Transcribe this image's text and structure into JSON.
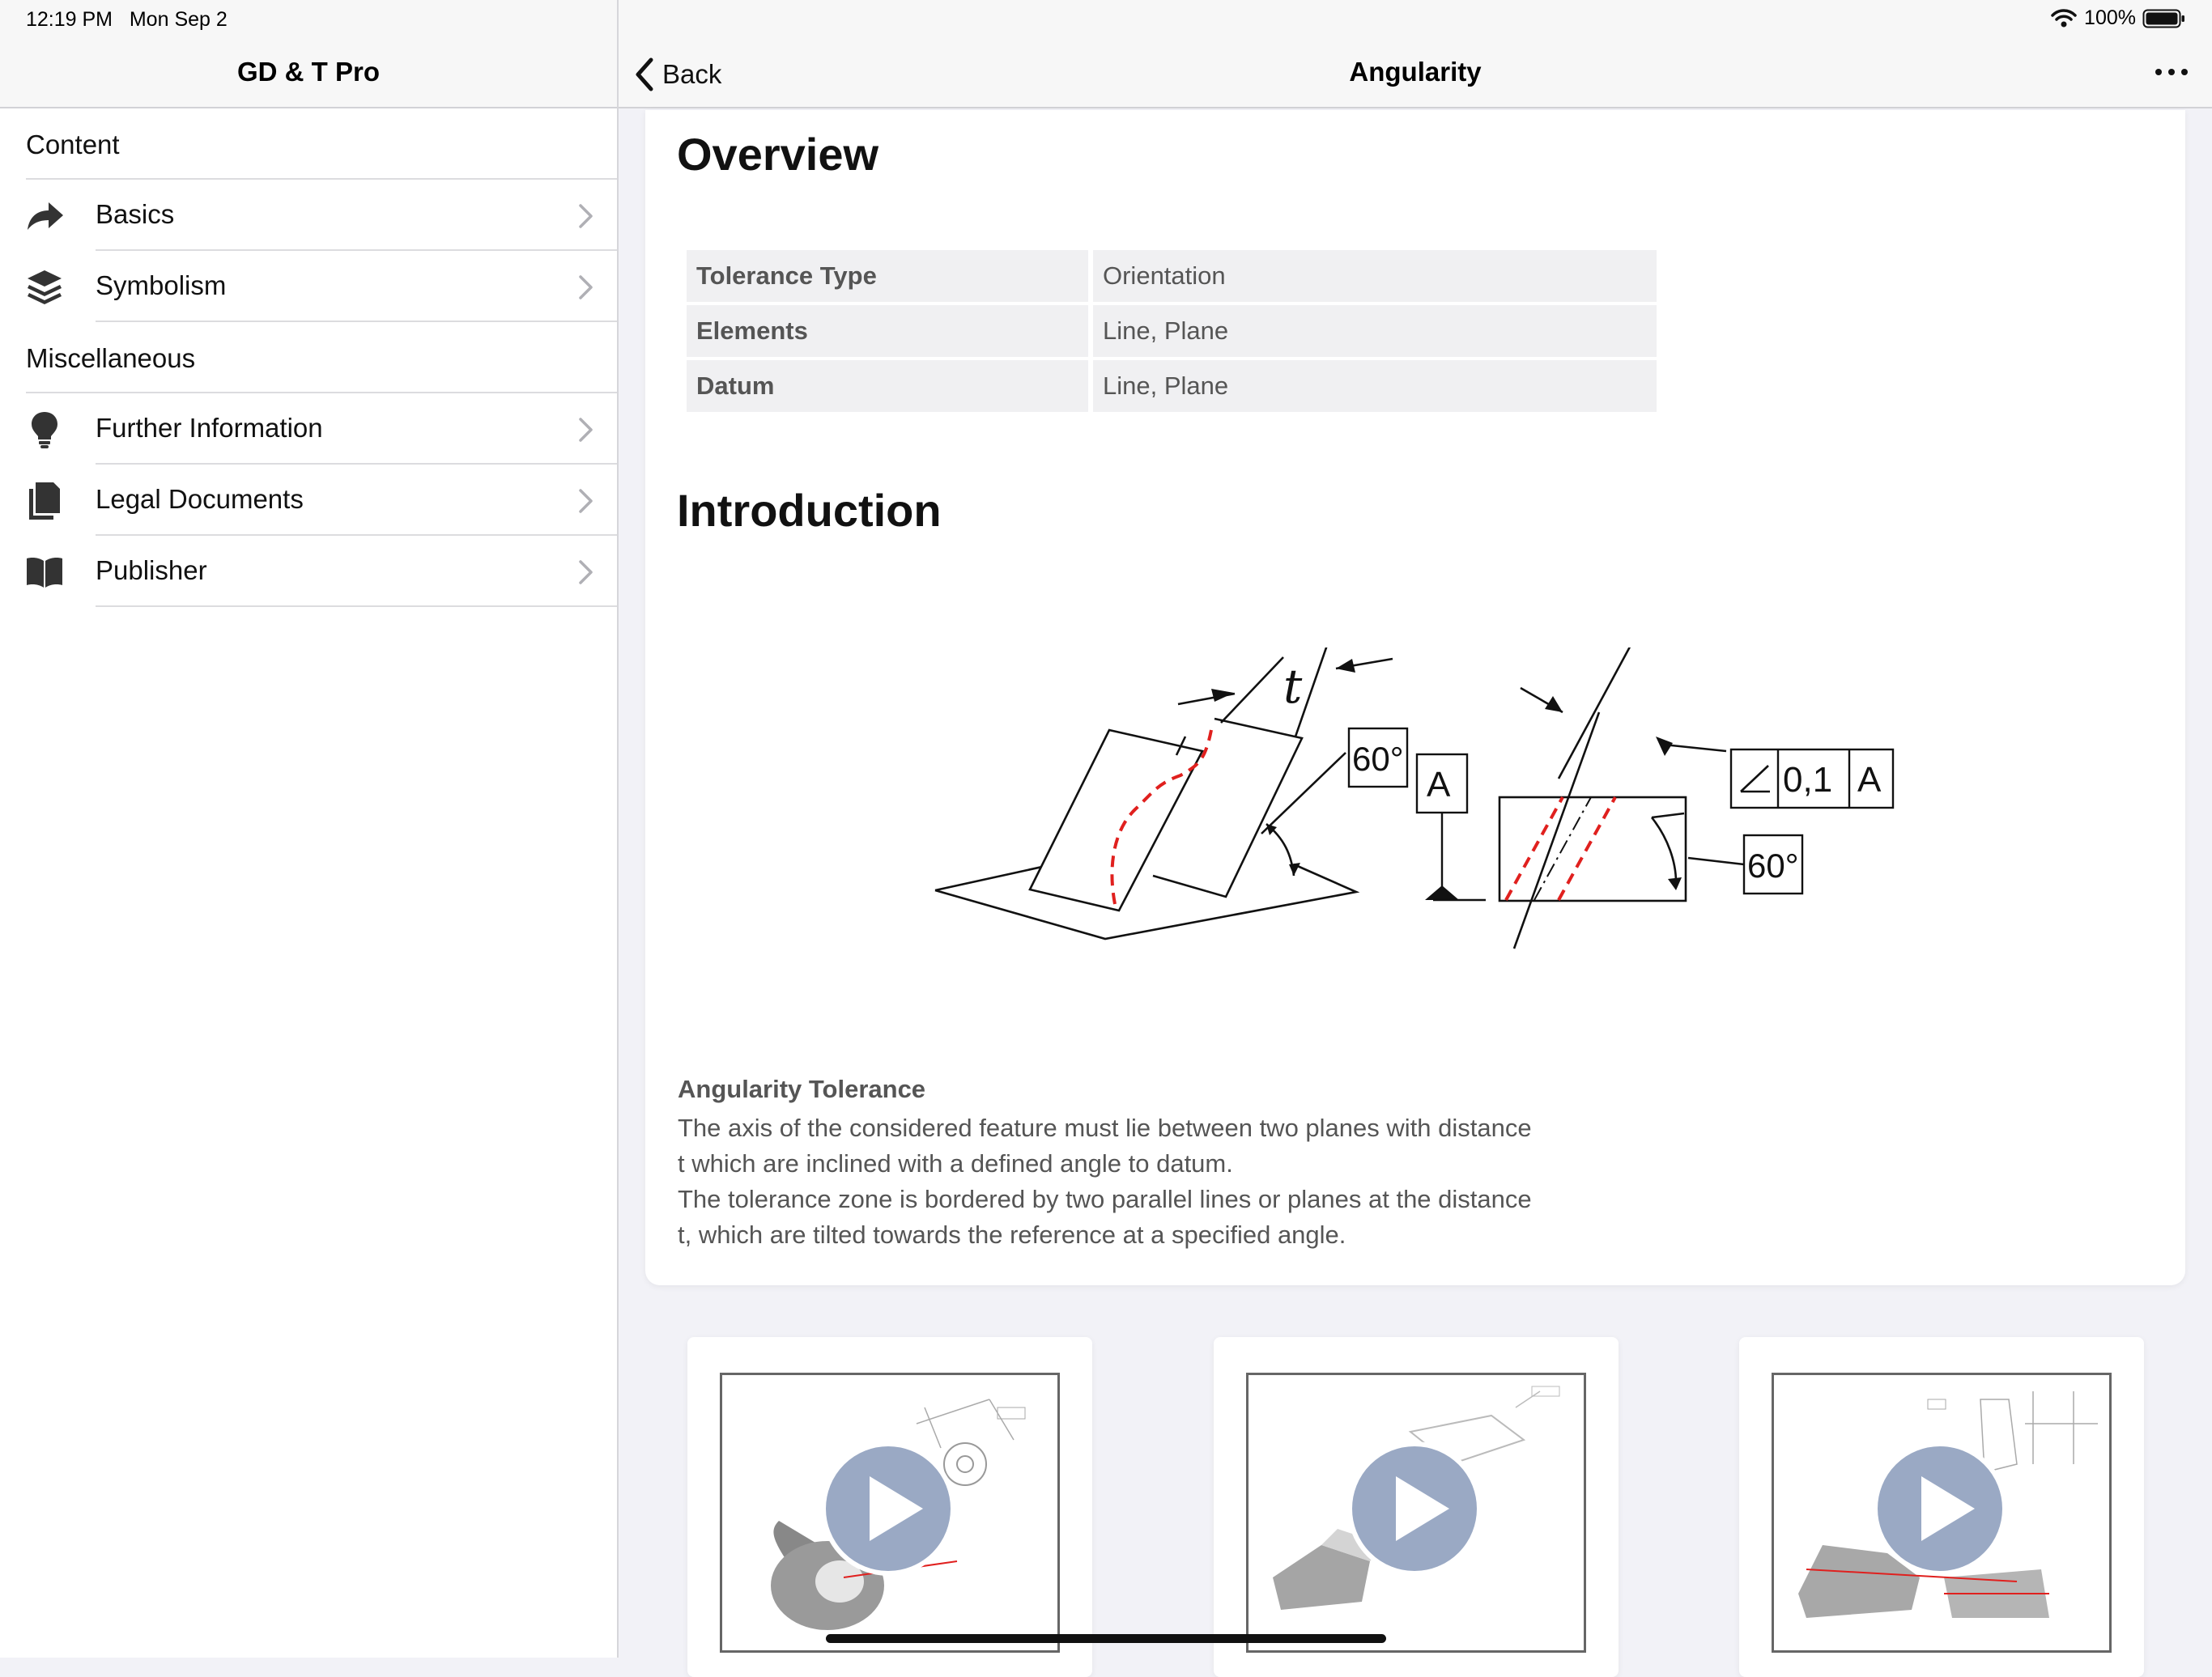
{
  "status_bar": {
    "time": "12:19 PM",
    "date": "Mon Sep 2",
    "battery": "100%"
  },
  "sidebar": {
    "title": "GD & T Pro",
    "sections": [
      {
        "header": "Content",
        "items": [
          {
            "label": "Basics",
            "icon": "share-arrow-icon"
          },
          {
            "label": "Symbolism",
            "icon": "layers-icon"
          }
        ]
      },
      {
        "header": "Miscellaneous",
        "items": [
          {
            "label": "Further Information",
            "icon": "lightbulb-icon"
          },
          {
            "label": "Legal Documents",
            "icon": "documents-icon"
          },
          {
            "label": "Publisher",
            "icon": "book-icon"
          }
        ]
      }
    ]
  },
  "header": {
    "back_label": "Back",
    "title": "Angularity"
  },
  "overview": {
    "heading": "Overview",
    "rows": [
      {
        "key": "Tolerance Type",
        "value": "Orientation"
      },
      {
        "key": "Elements",
        "value": "Line, Plane"
      },
      {
        "key": "Datum",
        "value": "Line, Plane"
      }
    ]
  },
  "introduction": {
    "heading": "Introduction",
    "diagram_labels": {
      "t": "t",
      "angle_left": "60°",
      "datum": "A",
      "frame_tol": "0,1",
      "frame_datum": "A",
      "angle_right": "60°"
    },
    "caption_title": "Angularity Tolerance",
    "caption_lines": [
      "The axis of the considered feature must lie between two planes with distance",
      "t which are inclined with a defined angle to datum.",
      "The tolerance zone is bordered by two parallel lines or planes at the distance",
      "t, which are tilted towards the reference at a specified angle."
    ]
  },
  "colors": {
    "accent_red": "#e0201e",
    "play_fill": "#9aa9c4"
  }
}
